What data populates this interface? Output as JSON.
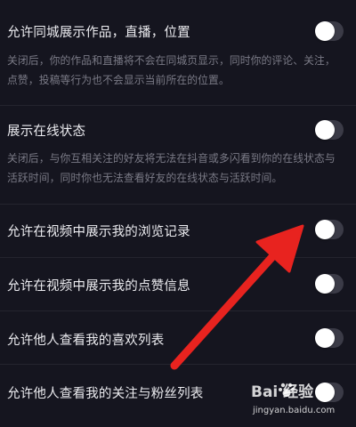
{
  "settings": [
    {
      "title": "允许同城展示作品，直播，位置",
      "desc": "关闭后，你的作品和直播将不会在同城页显示，同时你的评论、关注，点赞，投稿等行为也不会显示当前所在的位置。",
      "enabled": false
    },
    {
      "title": "展示在线状态",
      "desc": "关闭后，与你互相关注的好友将无法在抖音或多闪看到你的在线状态与活跃时间，同时你也无法查看好友的在线状态与活跃时间。",
      "enabled": false
    },
    {
      "title": "允许在视频中展示我的浏览记录",
      "enabled": false
    },
    {
      "title": "允许在视频中展示我的点赞信息",
      "enabled": false
    },
    {
      "title": "允许他人查看我的喜欢列表",
      "enabled": false
    },
    {
      "title": "允许他人查看我的关注与粉丝列表",
      "enabled": false
    }
  ],
  "watermark": {
    "logo": "Bai 经验",
    "url": "jingyan.baidu.com"
  },
  "colors": {
    "background": "#15151f",
    "title_text": "#ececf0",
    "desc_text": "#7a7a86",
    "toggle_off": "#3b3b47",
    "arrow": "#e8231f"
  },
  "icons": [
    "red-arrow-annotation-icon",
    "baidu-paw-icon"
  ]
}
